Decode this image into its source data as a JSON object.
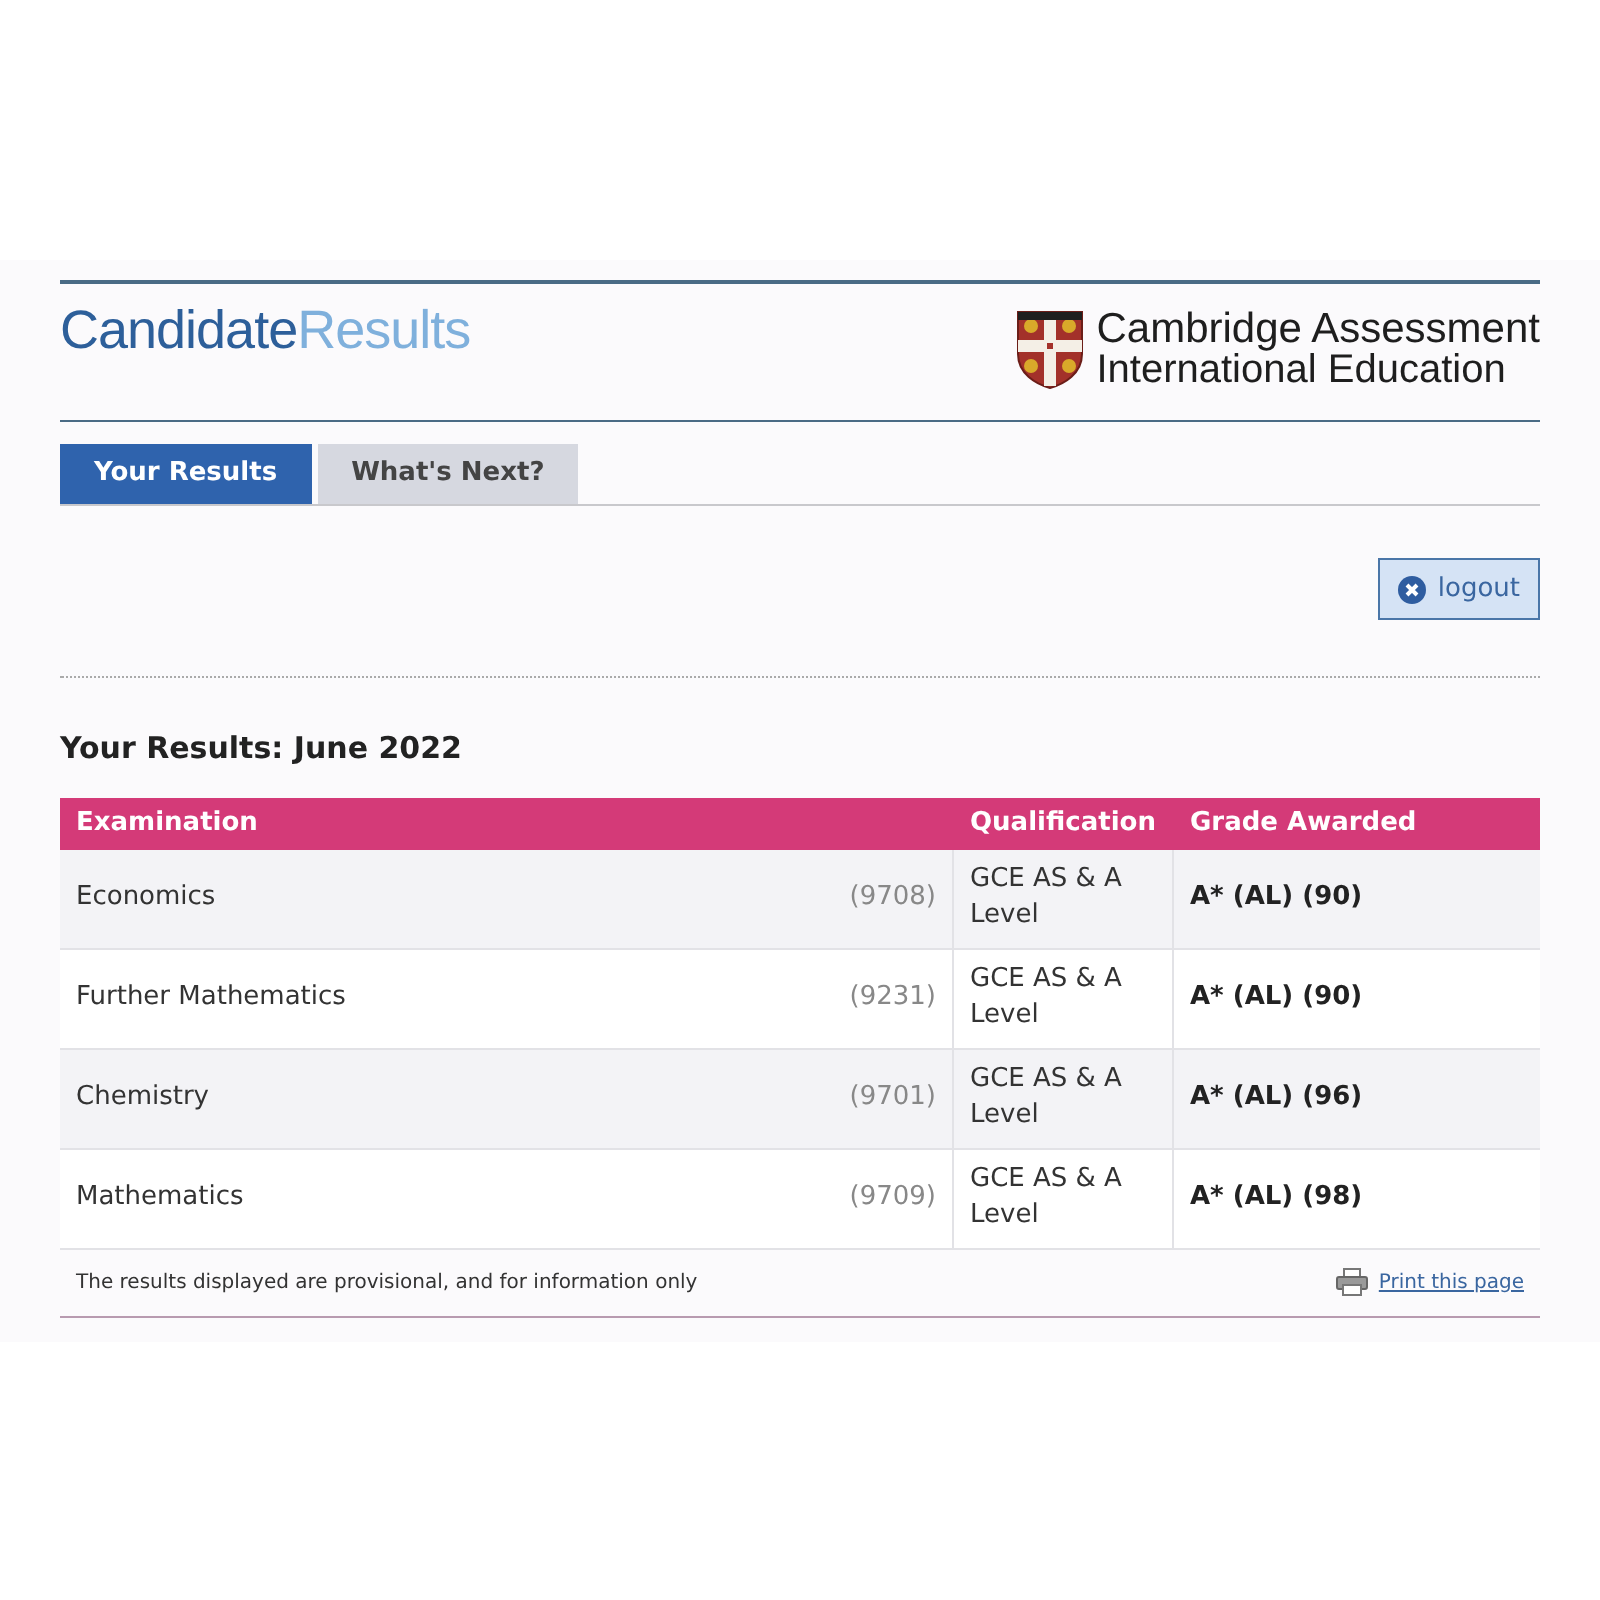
{
  "header": {
    "title_part_1": "Candidate",
    "title_part_2": "Results",
    "org_line_1": "Cambridge Assessment",
    "org_line_2": "International Education"
  },
  "tabs": [
    {
      "label": "Your Results",
      "selected": true
    },
    {
      "label": "What's Next?",
      "selected": false
    }
  ],
  "logout": "logout",
  "heading": "Your Results: June 2022",
  "table": {
    "columns": [
      "Examination",
      "Qualification",
      "Grade Awarded"
    ],
    "rows": [
      {
        "exam": "Economics",
        "code": "(9708)",
        "qualification": "GCE AS & A Level",
        "grade": "A* (AL) (90)"
      },
      {
        "exam": "Further Mathematics",
        "code": "(9231)",
        "qualification": "GCE AS & A Level",
        "grade": "A* (AL) (90)"
      },
      {
        "exam": "Chemistry",
        "code": "(9701)",
        "qualification": "GCE AS & A Level",
        "grade": "A* (AL) (96)"
      },
      {
        "exam": "Mathematics",
        "code": "(9709)",
        "qualification": "GCE AS & A Level",
        "grade": "A* (AL) (98)"
      }
    ]
  },
  "footer": {
    "note": "The results displayed are provisional, and for information only",
    "print_link": "Print this page"
  }
}
